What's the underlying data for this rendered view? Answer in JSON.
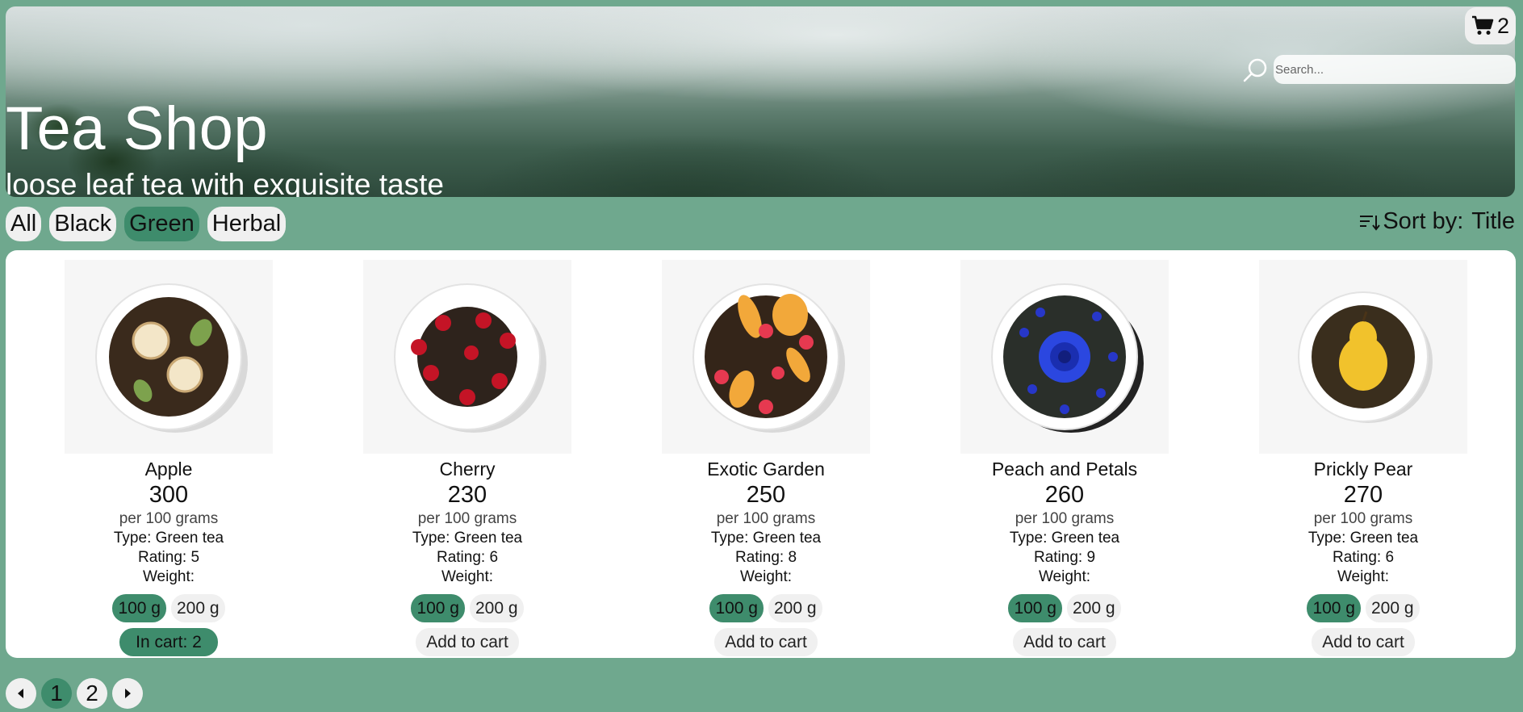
{
  "header": {
    "title": "Tea Shop",
    "subtitle": "loose leaf tea with exquisite taste",
    "search_placeholder": "Search...",
    "cart_count": "2"
  },
  "filters": [
    {
      "label": "All",
      "active": false
    },
    {
      "label": "Black",
      "active": false
    },
    {
      "label": "Green",
      "active": true
    },
    {
      "label": "Herbal",
      "active": false
    }
  ],
  "sort": {
    "label": "Sort by:",
    "value": "Title"
  },
  "products": [
    {
      "name": "Apple",
      "price": "300",
      "per": "per 100 grams",
      "type": "Type: Green tea",
      "rating": "Rating: 5",
      "weight_label": "Weight:",
      "weights": [
        "100 g",
        "200 g"
      ],
      "selected_weight": "100 g",
      "cart_label": "In cart: 2",
      "in_cart": true,
      "topping": "apple"
    },
    {
      "name": "Cherry",
      "price": "230",
      "per": "per 100 grams",
      "type": "Type: Green tea",
      "rating": "Rating: 6",
      "weight_label": "Weight:",
      "weights": [
        "100 g",
        "200 g"
      ],
      "selected_weight": "100 g",
      "cart_label": "Add to cart",
      "in_cart": false,
      "topping": "cherry"
    },
    {
      "name": "Exotic Garden",
      "price": "250",
      "per": "per 100 grams",
      "type": "Type: Green tea",
      "rating": "Rating: 8",
      "weight_label": "Weight:",
      "weights": [
        "100 g",
        "200 g"
      ],
      "selected_weight": "100 g",
      "cart_label": "Add to cart",
      "in_cart": false,
      "topping": "peach"
    },
    {
      "name": "Peach and Petals",
      "price": "260",
      "per": "per 100 grams",
      "type": "Type: Green tea",
      "rating": "Rating: 9",
      "weight_label": "Weight:",
      "weights": [
        "100 g",
        "200 g"
      ],
      "selected_weight": "100 g",
      "cart_label": "Add to cart",
      "in_cart": false,
      "topping": "cornflower"
    },
    {
      "name": "Prickly Pear",
      "price": "270",
      "per": "per 100 grams",
      "type": "Type: Green tea",
      "rating": "Rating: 6",
      "weight_label": "Weight:",
      "weights": [
        "100 g",
        "200 g"
      ],
      "selected_weight": "100 g",
      "cart_label": "Add to cart",
      "in_cart": false,
      "topping": "pear"
    }
  ],
  "pagination": {
    "pages": [
      "1",
      "2"
    ],
    "current": "1"
  },
  "colors": {
    "background": "#6fa88e",
    "accent": "#3e8c6c",
    "chip": "#f0f0f0",
    "panel": "#ffffff"
  },
  "icons": [
    "cart-icon",
    "search-icon",
    "sort-icon",
    "arrow-left-icon",
    "arrow-right-icon"
  ]
}
